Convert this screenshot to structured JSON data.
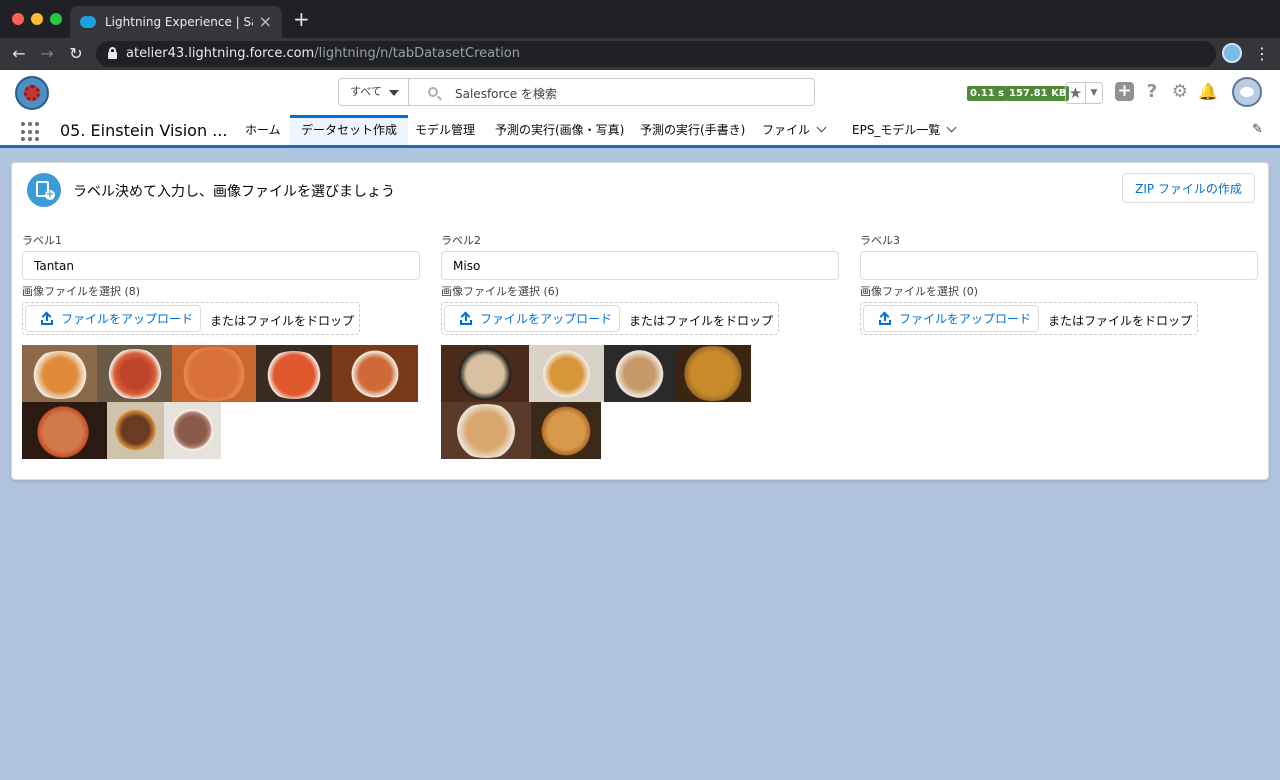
{
  "browser": {
    "tab_title": "Lightning Experience | Salesforce",
    "url_host": "atelier43.lightning.force.com",
    "url_path": "/lightning/n/tabDatasetCreation"
  },
  "header": {
    "search_scope": "すべて",
    "search_placeholder": "Salesforce を検索",
    "metric_time": "0.11 s",
    "metric_size": "157.81 KB"
  },
  "nav": {
    "app_name": "05. Einstein Vision ...",
    "tabs": [
      {
        "label": "ホーム"
      },
      {
        "label": "データセット作成"
      },
      {
        "label": "モデル管理"
      },
      {
        "label": "予測の実行(画像・写真)"
      },
      {
        "label": "予測の実行(手書き)"
      },
      {
        "label": "ファイル"
      },
      {
        "label": "EPS_モデル一覧"
      }
    ]
  },
  "card": {
    "title": "ラベル決めて入力し、画像ファイルを選びましょう",
    "zip_button": "ZIP ファイルの作成",
    "upload_button": "ファイルをアップロード",
    "drop_text": "またはファイルをドロップ",
    "columns": [
      {
        "label": "ラベル1",
        "value": "Tantan",
        "file_label": "画像ファイルを選択 (8)"
      },
      {
        "label": "ラベル2",
        "value": "Miso",
        "file_label": "画像ファイルを選択 (6)"
      },
      {
        "label": "ラベル3",
        "value": "",
        "file_label": "画像ファイルを選択 (0)"
      }
    ]
  },
  "colors": {
    "brand_blue": "#0070d2",
    "page_background": "#b0c3de",
    "metric_green": "#4f8a3b"
  }
}
